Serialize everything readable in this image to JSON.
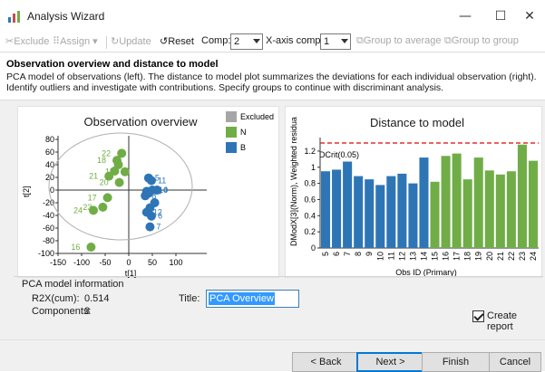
{
  "window": {
    "title": "Analysis Wizard",
    "minimize": "—",
    "maximize": "☐",
    "close": "✕"
  },
  "toolbar": {
    "exclude": "Exclude",
    "assign": "Assign",
    "update": "Update",
    "reset": "Reset",
    "comp_label": "Comp:",
    "comp_value": "2",
    "xaxis_label": "X-axis comp:",
    "xaxis_value": "1",
    "group_avg": "Group to average",
    "group_group": "Group to group"
  },
  "header": {
    "title": "Observation overview and distance to model",
    "description": "PCA model of observations (left). The distance to model plot summarizes the deviations for each individual observation (right). Identify outliers and investigate with contributions. Specify groups to continue with discriminant analysis."
  },
  "colors": {
    "excluded": "#a6a6a6",
    "N": "#70ad47",
    "B": "#2e75b6",
    "dcrit": "#e03131"
  },
  "chart_data": [
    {
      "type": "scatter",
      "title": "Observation overview",
      "xlabel": "t[1]",
      "ylabel": "t[2]",
      "xlim": [
        -150,
        150
      ],
      "ylim": [
        -100,
        80
      ],
      "xticks": [
        "-150",
        "-100",
        "-50",
        "0",
        "50",
        "100"
      ],
      "yticks": [
        "80",
        "60",
        "40",
        "20",
        "0",
        "-20",
        "-40",
        "-60",
        "-80",
        "-100"
      ],
      "legend": [
        "Excluded",
        "N",
        "B"
      ],
      "series": [
        {
          "name": "N",
          "points": [
            {
              "id": "16",
              "x": -80,
              "y": -90
            },
            {
              "id": "17",
              "x": -45,
              "y": -12
            },
            {
              "id": "18",
              "x": -25,
              "y": 47
            },
            {
              "id": "19",
              "x": -8,
              "y": 29
            },
            {
              "id": "20",
              "x": -20,
              "y": 12
            },
            {
              "id": "21",
              "x": -42,
              "y": 22
            },
            {
              "id": "22",
              "x": -15,
              "y": 58
            },
            {
              "id": "23",
              "x": -55,
              "y": -27
            },
            {
              "id": "24",
              "x": -75,
              "y": -32
            },
            {
              "id": "",
              "x": -30,
              "y": 30
            },
            {
              "id": "",
              "x": -22,
              "y": 40
            }
          ]
        },
        {
          "name": "B",
          "points": [
            {
              "id": "5",
              "x": 42,
              "y": 19
            },
            {
              "id": "6",
              "x": 48,
              "y": -41
            },
            {
              "id": "7",
              "x": 45,
              "y": -58
            },
            {
              "id": "8",
              "x": 35,
              "y": -9
            },
            {
              "id": "9",
              "x": 60,
              "y": 0
            },
            {
              "id": "10",
              "x": 38,
              "y": -2
            },
            {
              "id": "11",
              "x": 48,
              "y": 15
            },
            {
              "id": "12",
              "x": 38,
              "y": -35
            },
            {
              "id": "14",
              "x": 50,
              "y": 0
            },
            {
              "id": "",
              "x": 42,
              "y": -5
            },
            {
              "id": "",
              "x": 55,
              "y": -20
            },
            {
              "id": "",
              "x": 45,
              "y": -28
            }
          ]
        }
      ]
    },
    {
      "type": "bar",
      "title": "Distance to model",
      "xlabel": "Obs ID (Primary)",
      "ylabel": "DModX[3](Norm), Weighted residua",
      "ylim": [
        0,
        1.3
      ],
      "yticks": [
        "0",
        "0.2",
        "0.4",
        "0.6",
        "0.8",
        "1",
        "1.2"
      ],
      "dcrit_label": "DCrit(0.05)",
      "dcrit": 1.3,
      "categories": [
        "5",
        "6",
        "7",
        "8",
        "9",
        "10",
        "11",
        "12",
        "13",
        "14",
        "15",
        "16",
        "17",
        "18",
        "19",
        "20",
        "21",
        "22",
        "23",
        "24"
      ],
      "values": [
        0.95,
        0.97,
        1.07,
        0.89,
        0.85,
        0.78,
        0.89,
        0.92,
        0.8,
        1.12,
        0.82,
        1.14,
        1.17,
        0.85,
        1.12,
        0.96,
        0.91,
        0.95,
        1.28,
        1.08
      ],
      "groups": [
        "B",
        "B",
        "B",
        "B",
        "B",
        "B",
        "B",
        "B",
        "B",
        "B",
        "N",
        "N",
        "N",
        "N",
        "N",
        "N",
        "N",
        "N",
        "N",
        "N"
      ]
    }
  ],
  "info": {
    "group_title": "PCA model information",
    "r2x_label": "R2X(cum):",
    "r2x_value": "0.514",
    "components_label": "Components:",
    "components_value": "3",
    "title_label": "Title:",
    "title_value": "PCA Overview",
    "create_report": "Create report"
  },
  "footer": {
    "back": "< Back",
    "next": "Next >",
    "finish": "Finish",
    "cancel": "Cancel"
  }
}
